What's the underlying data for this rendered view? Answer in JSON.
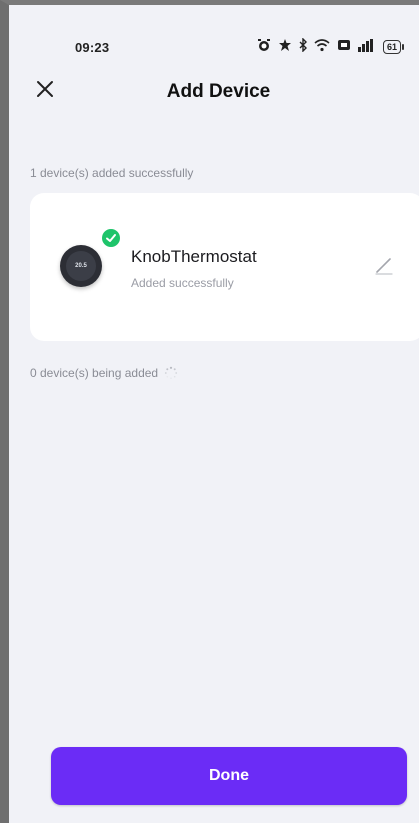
{
  "status_bar": {
    "time": "09:23",
    "battery": "61",
    "icons": [
      "alarm-icon",
      "do-not-disturb-icon",
      "bluetooth-icon",
      "wifi-icon",
      "nfc-icon",
      "signal-icon",
      "battery-icon"
    ]
  },
  "header": {
    "title": "Add Device",
    "close_icon": "close-icon"
  },
  "added_section": {
    "label": "1 device(s) added successfully",
    "devices": [
      {
        "name": "KnobThermostat",
        "status": "Added successfully",
        "display_value": "20.5",
        "status_color": "#1ec46a"
      }
    ]
  },
  "adding_section": {
    "label": "0 device(s) being added"
  },
  "footer": {
    "done_label": "Done"
  },
  "colors": {
    "accent": "#6b2cf6",
    "background": "#f1f2f7",
    "success": "#1ec46a"
  }
}
